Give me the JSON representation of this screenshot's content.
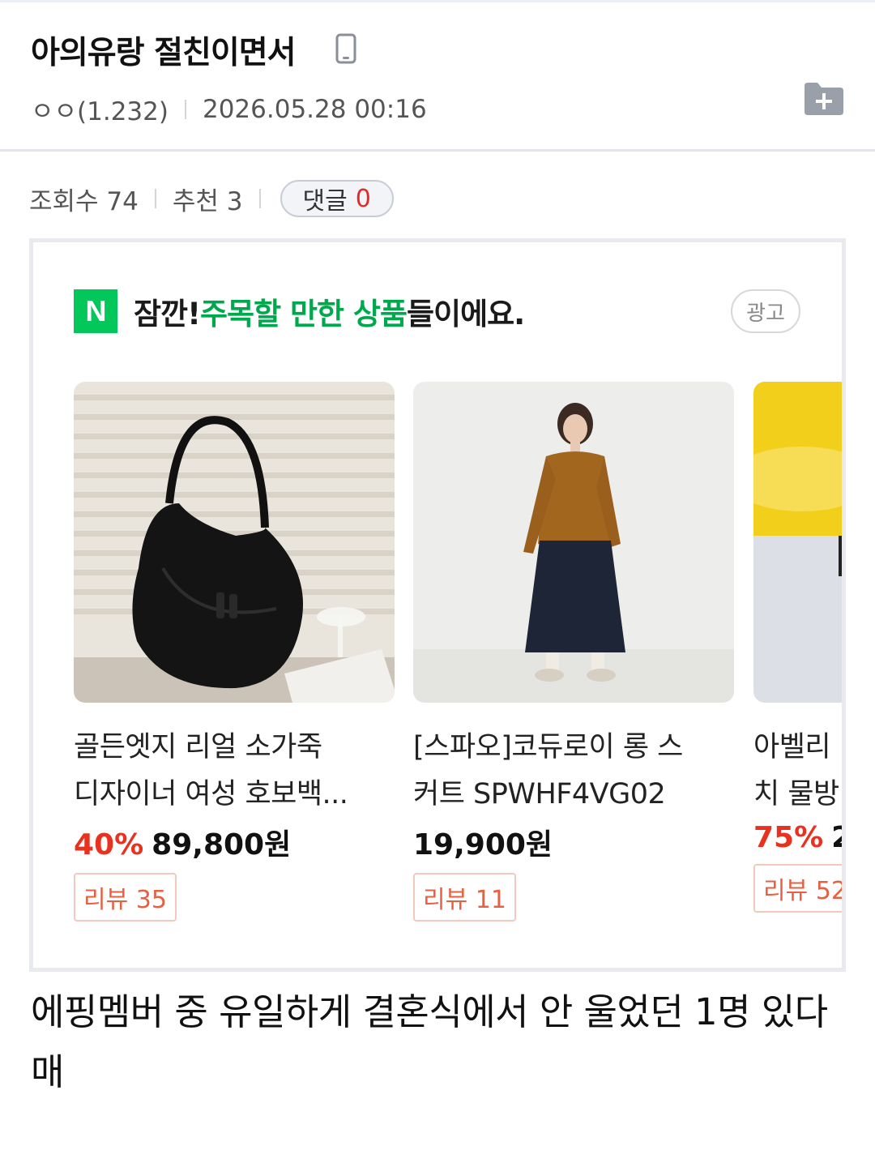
{
  "post": {
    "title": "아의유랑 절친이면서",
    "author": "ㅇㅇ(1.232)",
    "date": "2026.05.28 00:16",
    "views_label": "조회수 74",
    "recommend_label": "추천 3",
    "comment_label": "댓글",
    "comment_count": "0"
  },
  "ad": {
    "logo_letter": "N",
    "headline_prefix": "잠깐! ",
    "headline_highlight": "주목할 만한 상품",
    "headline_suffix": "들이에요.",
    "badge": "광고",
    "products": [
      {
        "name_line1": "골든엣지 리얼 소가죽",
        "name_line2": "디자이너 여성 호보백...",
        "discount": "40%",
        "price": "89,800원",
        "review": "리뷰 35"
      },
      {
        "name_line1": "[스파오]코듀로이 롱 스",
        "name_line2": "커트 SPWHF4VG02",
        "discount": "",
        "price": "19,900원",
        "review": "리뷰 11"
      },
      {
        "name_line1": "아벨리",
        "name_line2": "치 물방",
        "discount": "75%",
        "price": "2",
        "review": "리뷰 52"
      }
    ]
  },
  "body": {
    "text": "에핑멤버 중 유일하게 결혼식에서 안 울었던 1명 있다매"
  },
  "icons": {
    "mobile": "mobile-phone-icon",
    "folder": "folder-add-icon"
  },
  "colors": {
    "naver_green": "#03c75a",
    "highlight_green": "#00a84d",
    "discount_red": "#e8321f",
    "comment_red": "#e02b2b"
  }
}
